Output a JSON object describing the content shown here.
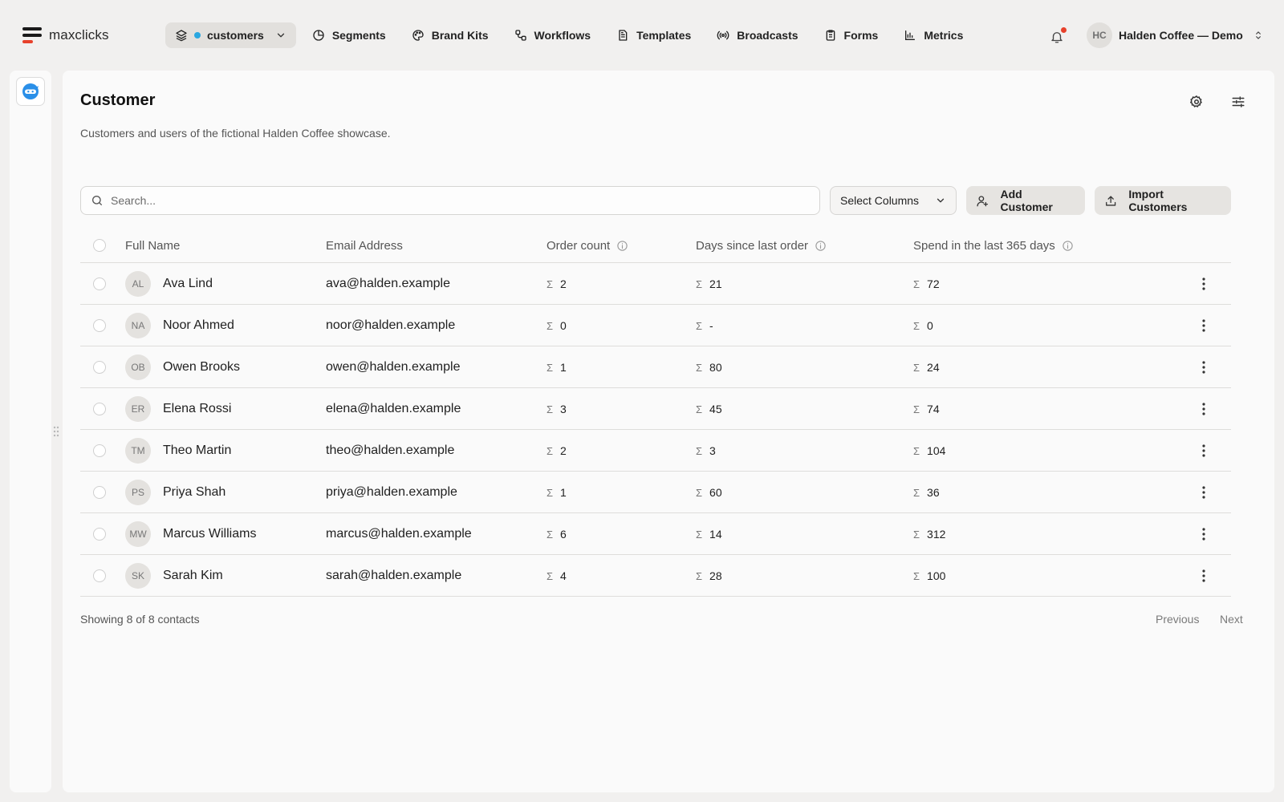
{
  "app": {
    "name": "maxclicks"
  },
  "nav": {
    "workspace_label": "customers",
    "items": [
      {
        "label": "Segments",
        "icon": "pie-chart-icon"
      },
      {
        "label": "Brand Kits",
        "icon": "palette-icon"
      },
      {
        "label": "Workflows",
        "icon": "workflow-icon"
      },
      {
        "label": "Templates",
        "icon": "document-icon"
      },
      {
        "label": "Broadcasts",
        "icon": "broadcast-icon"
      },
      {
        "label": "Forms",
        "icon": "clipboard-icon"
      },
      {
        "label": "Metrics",
        "icon": "bar-chart-icon"
      }
    ],
    "account": {
      "initials": "HC",
      "name": "Halden Coffee — Demo"
    }
  },
  "page": {
    "title": "Customer",
    "subtitle": "Customers and users of the fictional Halden Coffee showcase."
  },
  "toolbar": {
    "search_placeholder": "Search...",
    "select_columns_label": "Select Columns",
    "add_label": "Add Customer",
    "import_label": "Import Customers"
  },
  "table": {
    "headers": {
      "name": "Full Name",
      "email": "Email Address",
      "orders": "Order count",
      "days": "Days since last order",
      "spend": "Spend in the last 365 days"
    },
    "sum_symbol": "Σ",
    "rows": [
      {
        "initials": "AL",
        "name": "Ava Lind",
        "email": "ava@halden.example",
        "orders": "2",
        "days": "21",
        "spend": "72"
      },
      {
        "initials": "NA",
        "name": "Noor Ahmed",
        "email": "noor@halden.example",
        "orders": "0",
        "days": "-",
        "spend": "0"
      },
      {
        "initials": "OB",
        "name": "Owen Brooks",
        "email": "owen@halden.example",
        "orders": "1",
        "days": "80",
        "spend": "24"
      },
      {
        "initials": "ER",
        "name": "Elena Rossi",
        "email": "elena@halden.example",
        "orders": "3",
        "days": "45",
        "spend": "74"
      },
      {
        "initials": "TM",
        "name": "Theo Martin",
        "email": "theo@halden.example",
        "orders": "2",
        "days": "3",
        "spend": "104"
      },
      {
        "initials": "PS",
        "name": "Priya Shah",
        "email": "priya@halden.example",
        "orders": "1",
        "days": "60",
        "spend": "36"
      },
      {
        "initials": "MW",
        "name": "Marcus Williams",
        "email": "marcus@halden.example",
        "orders": "6",
        "days": "14",
        "spend": "312"
      },
      {
        "initials": "SK",
        "name": "Sarah Kim",
        "email": "sarah@halden.example",
        "orders": "4",
        "days": "28",
        "spend": "100"
      }
    ]
  },
  "footer": {
    "showing": "Showing 8 of 8 contacts",
    "previous": "Previous",
    "next": "Next"
  },
  "colors": {
    "accent_red": "#e7412b",
    "workspace_dot": "#2aa7e0",
    "rail_app_icon": "#2a8fe8"
  }
}
